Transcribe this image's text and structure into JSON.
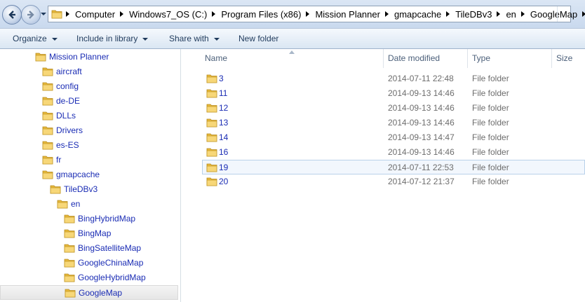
{
  "breadcrumb": [
    "Computer",
    "Windows7_OS (C:)",
    "Program Files (x86)",
    "Mission Planner",
    "gmapcache",
    "TileDBv3",
    "en",
    "GoogleMap"
  ],
  "toolbar": {
    "organize": "Organize",
    "include_library": "Include in library",
    "share_with": "Share with",
    "new_folder": "New folder"
  },
  "tree": [
    {
      "label": "Mission Planner",
      "level": 0
    },
    {
      "label": "aircraft",
      "level": 1
    },
    {
      "label": "config",
      "level": 1
    },
    {
      "label": "de-DE",
      "level": 1
    },
    {
      "label": "DLLs",
      "level": 1
    },
    {
      "label": "Drivers",
      "level": 1
    },
    {
      "label": "es-ES",
      "level": 1
    },
    {
      "label": "fr",
      "level": 1
    },
    {
      "label": "gmapcache",
      "level": 1
    },
    {
      "label": "TileDBv3",
      "level": 2
    },
    {
      "label": "en",
      "level": 3
    },
    {
      "label": "BingHybridMap",
      "level": 4
    },
    {
      "label": "BingMap",
      "level": 4
    },
    {
      "label": "BingSatelliteMap",
      "level": 4
    },
    {
      "label": "GoogleChinaMap",
      "level": 4
    },
    {
      "label": "GoogleHybridMap",
      "level": 4
    },
    {
      "label": "GoogleMap",
      "level": 4,
      "selected": true
    }
  ],
  "columns": {
    "name": "Name",
    "date": "Date modified",
    "type": "Type",
    "size": "Size"
  },
  "files": [
    {
      "name": "3",
      "date": "2014-07-11 22:48",
      "type": "File folder"
    },
    {
      "name": "11",
      "date": "2014-09-13 14:46",
      "type": "File folder"
    },
    {
      "name": "12",
      "date": "2014-09-13 14:46",
      "type": "File folder"
    },
    {
      "name": "13",
      "date": "2014-09-13 14:46",
      "type": "File folder"
    },
    {
      "name": "14",
      "date": "2014-09-13 14:47",
      "type": "File folder"
    },
    {
      "name": "16",
      "date": "2014-09-13 14:46",
      "type": "File folder"
    },
    {
      "name": "19",
      "date": "2014-07-11 22:53",
      "type": "File folder",
      "hover": true
    },
    {
      "name": "20",
      "date": "2014-07-12 21:37",
      "type": "File folder"
    }
  ],
  "colors": {
    "link_blue": "#1a2cb4",
    "folder_yellow": "#f2c94c",
    "header_text": "#4c607a"
  }
}
